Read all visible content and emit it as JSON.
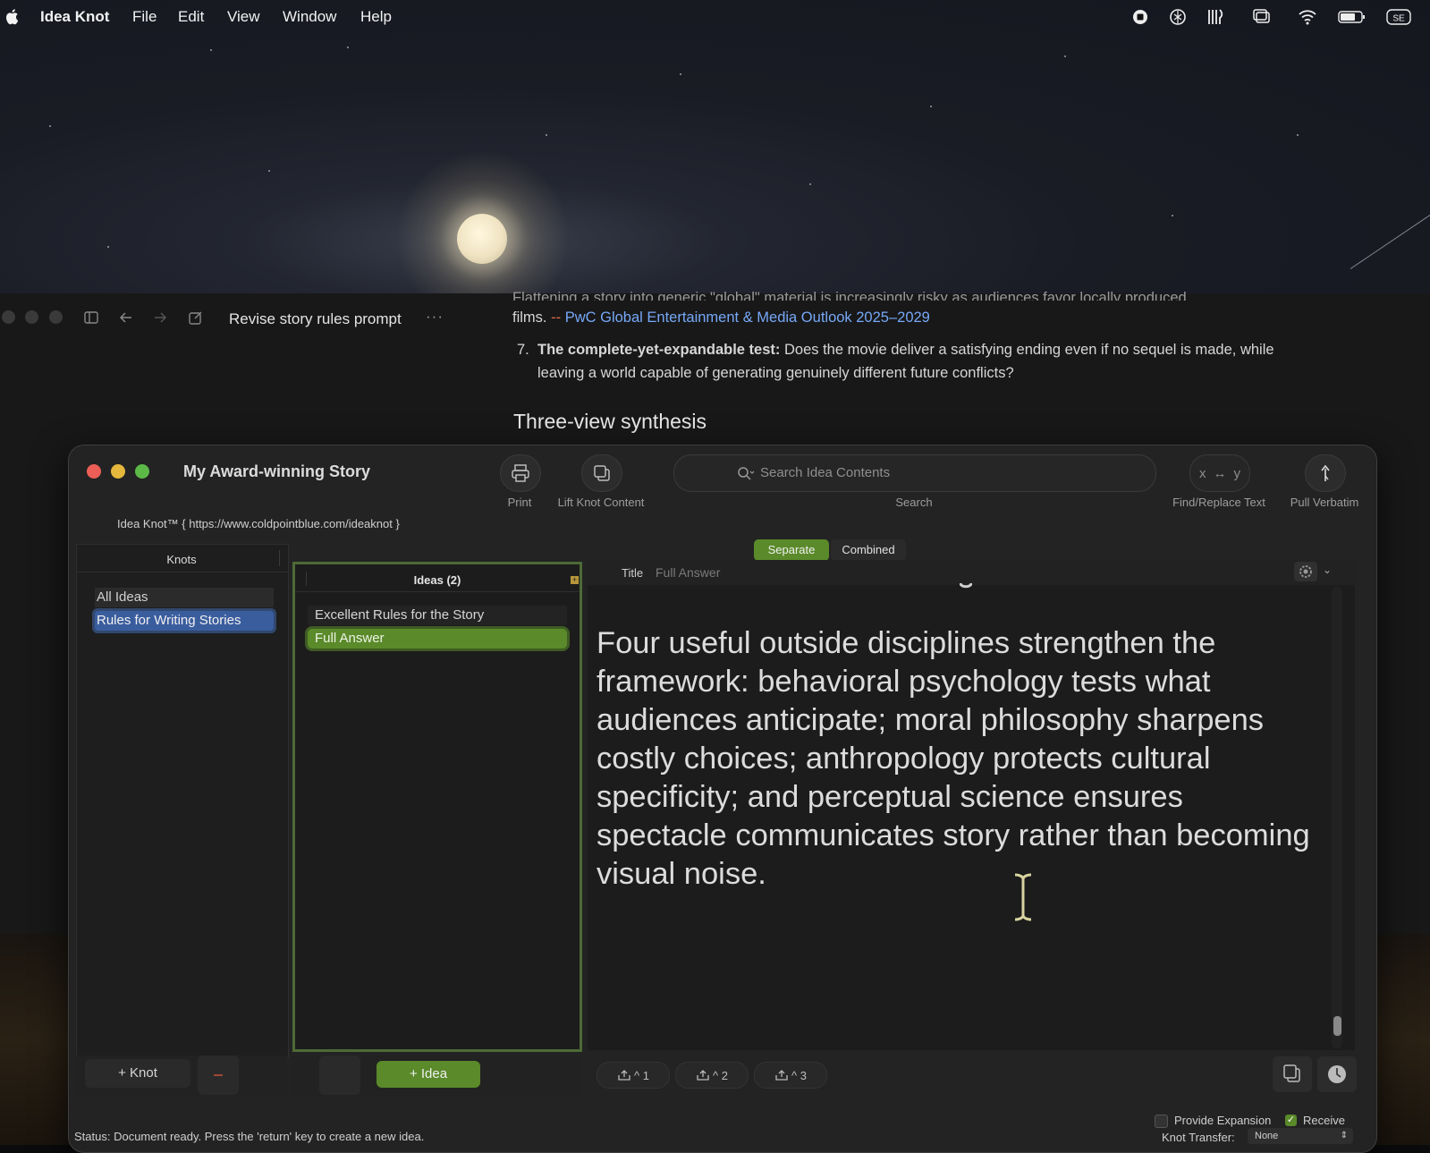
{
  "menubar": {
    "app_name": "Idea Knot",
    "items": [
      "File",
      "Edit",
      "View",
      "Window",
      "Help"
    ]
  },
  "background_app": {
    "title": "Revise story rules prompt",
    "faded_line": "Flattening a story into generic \"global\" material is increasingly risky as audiences favor locally produced",
    "line2_prefix": "films.",
    "line2_arrow": "-",
    "line2_link": "PwC Global Entertainment & Media Outlook 2025–2029",
    "item7_number": "7.",
    "item7_bold": "The complete-yet-expandable test:",
    "item7_text": "Does the movie deliver a satisfying ending even if no sequel is made, while leaving a world capable of generating genuinely different future conflicts?",
    "heading": "Three-view synthesis"
  },
  "window": {
    "title": "My Award-winning Story",
    "toolbar": {
      "print": "Print",
      "lift": "Lift Knot Content",
      "search_placeholder": "Search Idea Contents",
      "search_label": "Search",
      "find_x": "x",
      "find_arrow": "↔",
      "find_y": "y",
      "find_label": "Find/Replace Text",
      "pull_label": "Pull Verbatim"
    },
    "url_line": "Idea Knot™ { https://www.coldpointblue.com/ideaknot }",
    "knots": {
      "header": "Knots",
      "items": [
        "All Ideas",
        "Rules for Writing Stories"
      ]
    },
    "ideas": {
      "header": "Ideas (2)",
      "items": [
        "Excellent Rules for the Story",
        "Full Answer"
      ]
    },
    "segments": {
      "separate": "Separate",
      "combined": "Combined"
    },
    "editor": {
      "title_label": "Title",
      "title_value": "Full Answer",
      "body": "Four useful outside disciplines strengthen the framework: behavioral psychology tests what audiences anticipate; moral philosophy sharpens costly choices; anthropology protects cultural specificity; and perceptual science ensures spectacle communicates story rather than becoming visual noise."
    },
    "bottom": {
      "add_knot": "+ Knot",
      "add_idea": "+ Idea",
      "expansion_buttons": [
        "^ 1",
        "^ 2",
        "^ 3"
      ]
    },
    "status": "Status: Document ready. Press the 'return' key to create a new idea.",
    "provide_expansion": "Provide Expansion",
    "receive": "Receive",
    "receive_checked": true,
    "knot_transfer_label": "Knot Transfer:",
    "knot_transfer_value": "None"
  },
  "colors": {
    "accent_green": "#5a8a2a",
    "selection_blue": "#3a5d9e",
    "link_blue": "#76a8f7"
  }
}
